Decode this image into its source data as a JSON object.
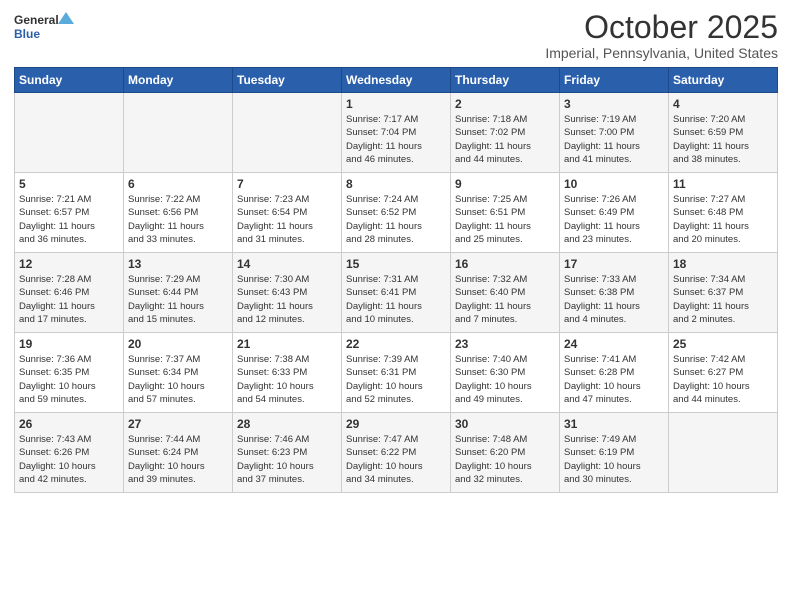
{
  "logo": {
    "general": "General",
    "blue": "Blue"
  },
  "header": {
    "month": "October 2025",
    "location": "Imperial, Pennsylvania, United States"
  },
  "weekdays": [
    "Sunday",
    "Monday",
    "Tuesday",
    "Wednesday",
    "Thursday",
    "Friday",
    "Saturday"
  ],
  "weeks": [
    [
      {
        "day": "",
        "info": ""
      },
      {
        "day": "",
        "info": ""
      },
      {
        "day": "",
        "info": ""
      },
      {
        "day": "1",
        "info": "Sunrise: 7:17 AM\nSunset: 7:04 PM\nDaylight: 11 hours\nand 46 minutes."
      },
      {
        "day": "2",
        "info": "Sunrise: 7:18 AM\nSunset: 7:02 PM\nDaylight: 11 hours\nand 44 minutes."
      },
      {
        "day": "3",
        "info": "Sunrise: 7:19 AM\nSunset: 7:00 PM\nDaylight: 11 hours\nand 41 minutes."
      },
      {
        "day": "4",
        "info": "Sunrise: 7:20 AM\nSunset: 6:59 PM\nDaylight: 11 hours\nand 38 minutes."
      }
    ],
    [
      {
        "day": "5",
        "info": "Sunrise: 7:21 AM\nSunset: 6:57 PM\nDaylight: 11 hours\nand 36 minutes."
      },
      {
        "day": "6",
        "info": "Sunrise: 7:22 AM\nSunset: 6:56 PM\nDaylight: 11 hours\nand 33 minutes."
      },
      {
        "day": "7",
        "info": "Sunrise: 7:23 AM\nSunset: 6:54 PM\nDaylight: 11 hours\nand 31 minutes."
      },
      {
        "day": "8",
        "info": "Sunrise: 7:24 AM\nSunset: 6:52 PM\nDaylight: 11 hours\nand 28 minutes."
      },
      {
        "day": "9",
        "info": "Sunrise: 7:25 AM\nSunset: 6:51 PM\nDaylight: 11 hours\nand 25 minutes."
      },
      {
        "day": "10",
        "info": "Sunrise: 7:26 AM\nSunset: 6:49 PM\nDaylight: 11 hours\nand 23 minutes."
      },
      {
        "day": "11",
        "info": "Sunrise: 7:27 AM\nSunset: 6:48 PM\nDaylight: 11 hours\nand 20 minutes."
      }
    ],
    [
      {
        "day": "12",
        "info": "Sunrise: 7:28 AM\nSunset: 6:46 PM\nDaylight: 11 hours\nand 17 minutes."
      },
      {
        "day": "13",
        "info": "Sunrise: 7:29 AM\nSunset: 6:44 PM\nDaylight: 11 hours\nand 15 minutes."
      },
      {
        "day": "14",
        "info": "Sunrise: 7:30 AM\nSunset: 6:43 PM\nDaylight: 11 hours\nand 12 minutes."
      },
      {
        "day": "15",
        "info": "Sunrise: 7:31 AM\nSunset: 6:41 PM\nDaylight: 11 hours\nand 10 minutes."
      },
      {
        "day": "16",
        "info": "Sunrise: 7:32 AM\nSunset: 6:40 PM\nDaylight: 11 hours\nand 7 minutes."
      },
      {
        "day": "17",
        "info": "Sunrise: 7:33 AM\nSunset: 6:38 PM\nDaylight: 11 hours\nand 4 minutes."
      },
      {
        "day": "18",
        "info": "Sunrise: 7:34 AM\nSunset: 6:37 PM\nDaylight: 11 hours\nand 2 minutes."
      }
    ],
    [
      {
        "day": "19",
        "info": "Sunrise: 7:36 AM\nSunset: 6:35 PM\nDaylight: 10 hours\nand 59 minutes."
      },
      {
        "day": "20",
        "info": "Sunrise: 7:37 AM\nSunset: 6:34 PM\nDaylight: 10 hours\nand 57 minutes."
      },
      {
        "day": "21",
        "info": "Sunrise: 7:38 AM\nSunset: 6:33 PM\nDaylight: 10 hours\nand 54 minutes."
      },
      {
        "day": "22",
        "info": "Sunrise: 7:39 AM\nSunset: 6:31 PM\nDaylight: 10 hours\nand 52 minutes."
      },
      {
        "day": "23",
        "info": "Sunrise: 7:40 AM\nSunset: 6:30 PM\nDaylight: 10 hours\nand 49 minutes."
      },
      {
        "day": "24",
        "info": "Sunrise: 7:41 AM\nSunset: 6:28 PM\nDaylight: 10 hours\nand 47 minutes."
      },
      {
        "day": "25",
        "info": "Sunrise: 7:42 AM\nSunset: 6:27 PM\nDaylight: 10 hours\nand 44 minutes."
      }
    ],
    [
      {
        "day": "26",
        "info": "Sunrise: 7:43 AM\nSunset: 6:26 PM\nDaylight: 10 hours\nand 42 minutes."
      },
      {
        "day": "27",
        "info": "Sunrise: 7:44 AM\nSunset: 6:24 PM\nDaylight: 10 hours\nand 39 minutes."
      },
      {
        "day": "28",
        "info": "Sunrise: 7:46 AM\nSunset: 6:23 PM\nDaylight: 10 hours\nand 37 minutes."
      },
      {
        "day": "29",
        "info": "Sunrise: 7:47 AM\nSunset: 6:22 PM\nDaylight: 10 hours\nand 34 minutes."
      },
      {
        "day": "30",
        "info": "Sunrise: 7:48 AM\nSunset: 6:20 PM\nDaylight: 10 hours\nand 32 minutes."
      },
      {
        "day": "31",
        "info": "Sunrise: 7:49 AM\nSunset: 6:19 PM\nDaylight: 10 hours\nand 30 minutes."
      },
      {
        "day": "",
        "info": ""
      }
    ]
  ]
}
